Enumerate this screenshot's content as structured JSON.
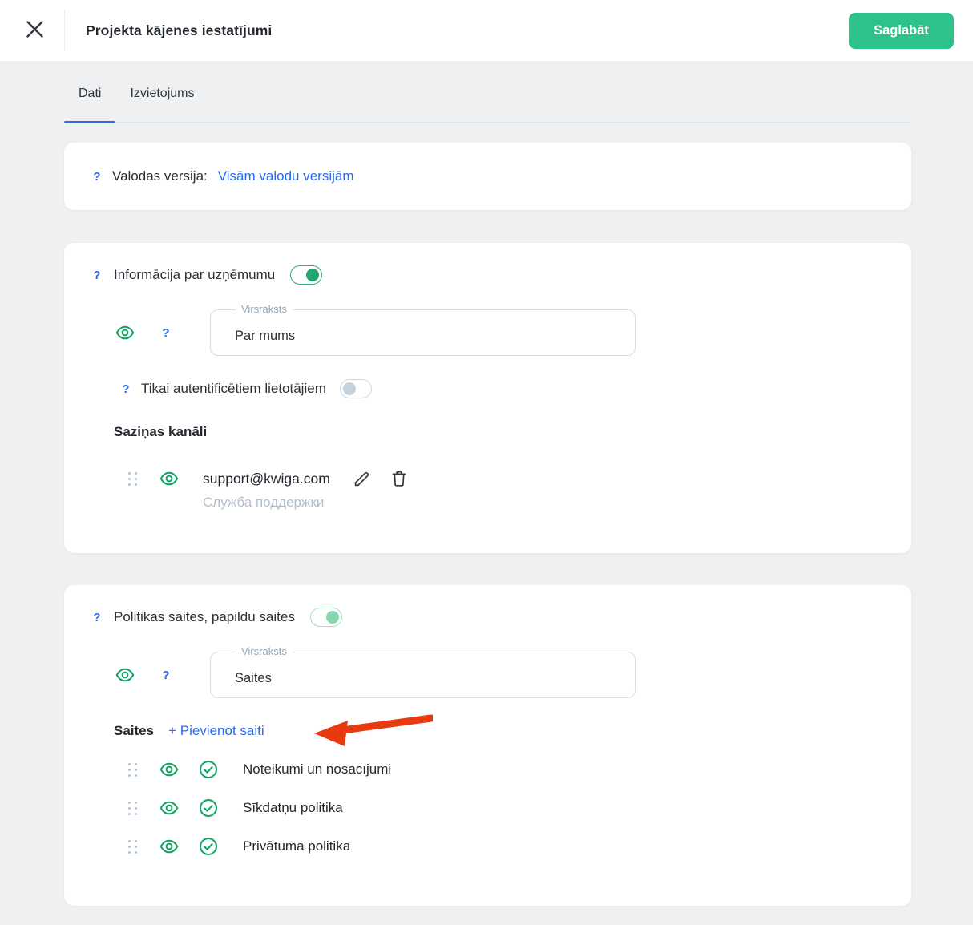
{
  "header": {
    "title": "Projekta kājenes iestatījumi",
    "save_label": "Saglabāt"
  },
  "tabs": [
    {
      "label": "Dati",
      "active": true
    },
    {
      "label": "Izvietojums",
      "active": false
    }
  ],
  "help_glyph": "?",
  "language_card": {
    "label": "Valodas versija:",
    "value_link": "Visām valodu versijām"
  },
  "company_card": {
    "title": "Informācija par uzņēmumu",
    "toggle_on": true,
    "field_label": "Virsraksts",
    "field_value": "Par mums",
    "auth_label": "Tikai autentificētiem lietotājiem",
    "auth_toggle_on": false,
    "channels_title": "Saziņas kanāli",
    "channel": {
      "email": "support@kwiga.com",
      "description": "Служба поддержки"
    }
  },
  "links_card": {
    "title": "Politikas saites, papildu saites",
    "toggle_on": true,
    "field_label": "Virsraksts",
    "field_value": "Saites",
    "links_title": "Saites",
    "add_link_label": "+ Pievienot saiti",
    "links": [
      {
        "label": "Noteikumi un nosacījumi"
      },
      {
        "label": "Sīkdatņu politika"
      },
      {
        "label": "Privātuma politika"
      }
    ]
  },
  "colors": {
    "accent_blue": "#2b6bf0",
    "icon_green": "#12a364",
    "save_button_green": "#2ec28b",
    "toggle_on_green": "#22a56e",
    "toggle_light_green": "#86d6b0",
    "arrow_red": "#e83a10",
    "background": "#eef0f2"
  }
}
